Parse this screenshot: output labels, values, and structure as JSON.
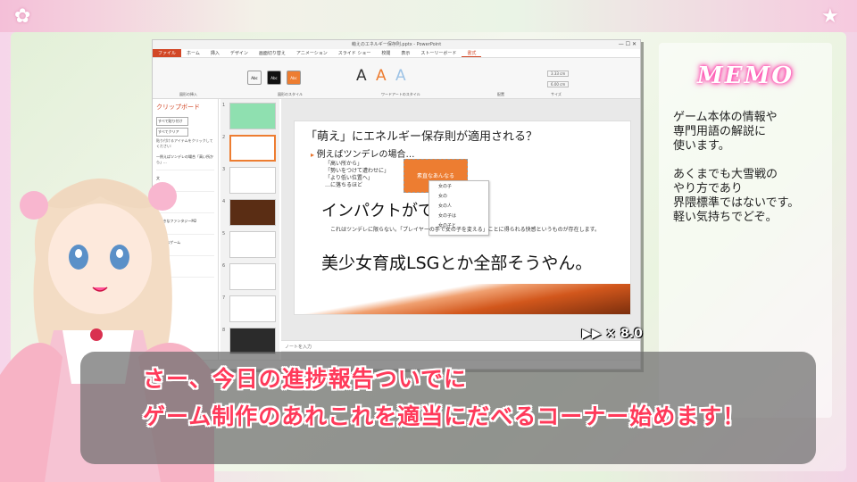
{
  "ppt": {
    "title": "萌えのエネルギー保存則.pptx - PowerPoint",
    "tabs": [
      "ファイル",
      "ホーム",
      "挿入",
      "デザイン",
      "画面切り替え",
      "アニメーション",
      "スライド ショー",
      "校閲",
      "表示",
      "ストーリーボード",
      "書式"
    ],
    "ribbon_letters": [
      "A",
      "A",
      "A"
    ],
    "ribbon_size1": "3.33 cm",
    "ribbon_size2": "6.00 cm",
    "ribbon_group_labels": [
      "図形の挿入",
      "図形のスタイル",
      "ワードアートのスタイル",
      "配置",
      "サイズ"
    ],
    "clipboard": {
      "title": "クリップボード",
      "paste_all": "すべて貼り付け",
      "clear_all": "すべてクリア",
      "hint": "貼り付けるアイテムをクリックしてください:",
      "items": [
        "一例えばツンデレの場合「高い所から」...",
        "文",
        "文",
        "",
        "",
        "※好きなファンタジーM2",
        "※好きなゲーム",
        "",
        "うし"
      ]
    },
    "slide": {
      "title": "「萌え」にエネルギー保存則が適用される？",
      "bullet": "例えばツンデレの場合…",
      "left_lines": [
        "「高い所から」",
        "「勢いをつけて遭わせに」",
        "「より低い位置へ」",
        "…に落ちるほど"
      ],
      "orange_box_text": "素直なあんなる",
      "popup_items": [
        "女の子",
        "女の",
        "女の人",
        "女の子は",
        "女の子と"
      ],
      "impact": "インパクトがで",
      "sub": "これはツンデレに限らない。「プレイヤーの手で女の子を変える」ことに得られる快感というものが存在します。",
      "big_line": "美少女育成LSGとか全部そうやん。"
    },
    "notes": "ノートを入力",
    "speed": "▶▶ × 8.0"
  },
  "memo": {
    "title": "MEMO",
    "text": "ゲーム本体の情報や\n専門用語の解説に\n使います。\n\nあくまでも大雪戦の\nやり方であり\n界隈標準ではないです。\n軽い気持ちでどぞ。"
  },
  "subtitle": {
    "line1": "さー、今日の進捗報告ついでに",
    "line2": "ゲーム制作のあれこれを適当にだべるコーナー始めます！"
  },
  "colors": {
    "accent": "#d24726",
    "slide_orange": "#ed7d31",
    "subtitle_text": "#ff3a5a",
    "memo_glow": "#ff3ca8"
  }
}
